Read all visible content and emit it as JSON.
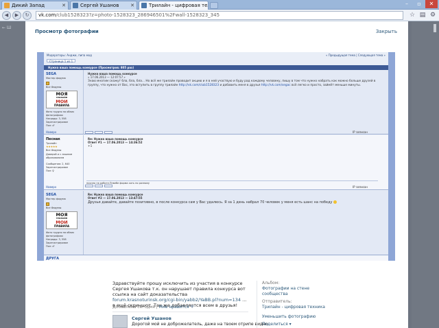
{
  "browser": {
    "tabs": [
      {
        "label": "Дикий Запад",
        "active": false,
        "color": "#e8a23a"
      },
      {
        "label": "Сергей Ушанов",
        "active": false,
        "color": "#4a76a8"
      },
      {
        "label": "Трилайн - цифровая тел...",
        "active": true,
        "color": "#4a76a8"
      }
    ],
    "url_host": "vk.com",
    "url_path": "/club1528323?z=photo-1528323_286946501%2Fwall-1528323_345"
  },
  "background": {
    "left_text": "← Ш"
  },
  "viewer": {
    "title": "Просмотр фотографии",
    "close_label": "Закрыть"
  },
  "forum": {
    "breadcrumb": "Модераторы: Анджи, пипа мод",
    "pagination": "« Предыдущая тема | Следующая тема »",
    "pages": "Страница 1 из 1",
    "topic_title": "Нужна ваша помощь конкурсе (Просмотров: 805 раз)",
    "posts": [
      {
        "user": "SEGA",
        "rank": "Мастер форума",
        "role": "Все Форумы",
        "logo_top": "МОЯ",
        "logo_mid": "ТРИЛАЙН",
        "logo_red": "МОИ",
        "logo_bottom": "ПРАВИЛА",
        "meta1": "Фото трудно на обеих фотографиях",
        "meta2": "Награды: 3, 558 Зарегистрирован",
        "meta3": "Пол: ♂",
        "title": "Нужна ваша помощь конкурсе",
        "date": "« 17.06.2013 — 12:07:57 »",
        "text": "Знаю многим скажут бла, бла, бла... Но всё же трилайн проводит акцию и я в ней участвую и буду рад каждому человеку, пишу в том что нужно набрать как можно больше друзей в группу, что нужно от Вас, это вступить в группу трилайн",
        "link1": "http://vk.com/club1528323",
        "text2": "и добавить меня в друзья",
        "link2": "http://vk.com/segac",
        "text3": "всё легко и просто, займёт меньше минуты.",
        "top_label": "Наверх",
        "reply_label": "IP записан"
      },
      {
        "user": "Песнак",
        "rank": "Трилайн",
        "stars": "★★★★★",
        "role": "Все Форумы",
        "meta1": "Доверяй и с лишним образованием",
        "meta2": "Сообщения: 2, 640 Зарегистрирован",
        "meta3": "Пол: ♀",
        "title": "Re: Нужна ваша помощь конкурсе",
        "date": "Ответ #1 — 17.06.2013 — 14:36:52",
        "text": "+1",
        "sig": "ниочно на работе.Ппвебе форма хоть по разному",
        "top_label": "Наверх",
        "reply_label": "IP записан"
      },
      {
        "user": "SEGA",
        "rank": "Мастер форума",
        "role": "Все Форумы",
        "logo_top": "МОЯ",
        "logo_mid": "ТРИЛАЙН",
        "logo_red": "МОИ",
        "logo_bottom": "ПРАВИЛА",
        "meta1": "Фото трудно на обеих фотографиях",
        "meta2": "Награды: 3, 558 Зарегистрирован",
        "meta3": "Пол: ♂",
        "title": "Re: Нужна ваша помощь конкурсе",
        "date": "Ответ #2 — 17.06.2013 — 13:47:55",
        "text": "Друзья давайте, давайте позитивно, в после конкурса сам у Вас удалюсь. Я за 1 день набрал 70 человек у меня есть шанс на победу",
        "top_label": "Наверх",
        "reply_label": "IP записан"
      }
    ],
    "next_user": "ДРУГА"
  },
  "caption": {
    "line1": "Здравствуйте прошу исключить из участия в конкурсе Сергея Ушакова т.к.",
    "line2": "он нарушает правила конкурса вот ссылка на сайт доказательства",
    "link": "forum.krasnoturinsk.org/cgi-bin/yabb2/YaBB.pl?num=134",
    "line3": "... в ещё скриншот. Так",
    "line4": "же добавляется всем в друзья!"
  },
  "byline": {
    "added": "Добавлена сегодня",
    "like": "Мне нравится",
    "heart": "♥"
  },
  "comment": {
    "name": "Сергей Ушанов",
    "text": "Дорогой мой не доброжелатель, даже на твоем отрипе видно"
  },
  "sidebar": {
    "album_label": "Альбом:",
    "album_name": "Фотографии на стене сообщества",
    "sender_label": "Отправитель:",
    "sender_name": "Трилайн - цифровая техника",
    "reduce": "Уменьшить фотографию",
    "share": "Поделиться ▾"
  }
}
